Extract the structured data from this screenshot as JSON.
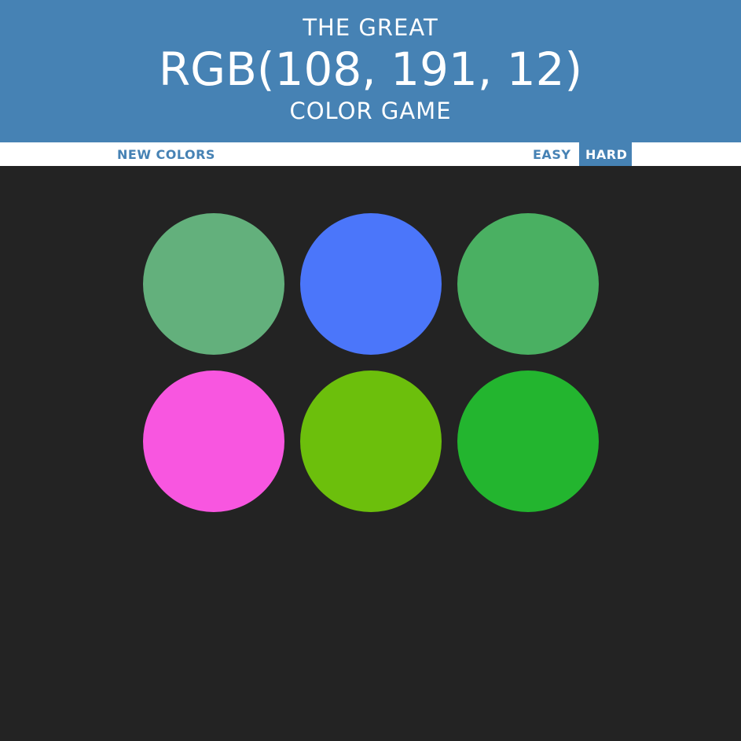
{
  "header": {
    "line1": "THE GREAT",
    "color_display": "RGB(108, 191, 12)",
    "line3": "COLOR GAME",
    "background": "#4682b4"
  },
  "stripe": {
    "new_colors_label": "NEW COLORS",
    "easy_label": "EASY",
    "hard_label": "HARD",
    "selected_mode": "HARD"
  },
  "squares": [
    {
      "color": "rgb(99, 176, 124)"
    },
    {
      "color": "rgb(75, 118, 250)"
    },
    {
      "color": "rgb(74, 176, 98)"
    },
    {
      "color": "rgb(248, 86, 224)"
    },
    {
      "color": "rgb(108, 191, 12)"
    },
    {
      "color": "rgb(35, 181, 47)"
    }
  ],
  "colors": {
    "background": "#232323",
    "accent": "#4682b4"
  }
}
